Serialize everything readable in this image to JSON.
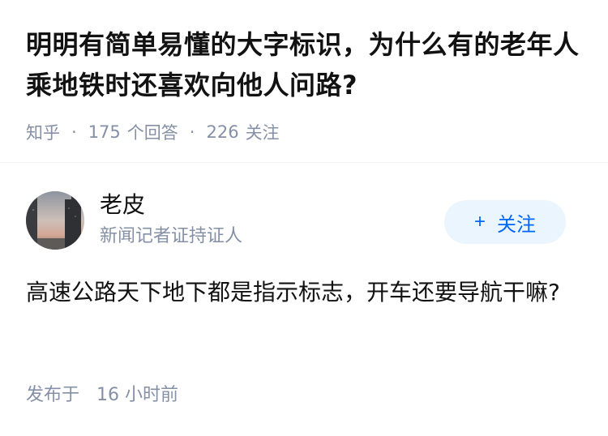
{
  "question": {
    "title": "明明有简单易懂的大字标识，为什么有的老年人乘地铁时还喜欢向他人问路?",
    "source": "知乎",
    "separator": "·",
    "answer_count": "175",
    "answer_label": "个回答",
    "follower_count": "226",
    "follower_label": "关注"
  },
  "answer": {
    "author": {
      "name": "老皮",
      "description": "新闻记者证持证人",
      "avatar_icon": "avatar-photo"
    },
    "follow_button": {
      "icon": "plus-icon",
      "icon_glyph": "+",
      "label": "关注"
    },
    "content": "高速公路天下地下都是指示标志，开车还要导航干嘛?",
    "time_label": "发布于",
    "time_value": "16 小时前"
  },
  "colors": {
    "title": "#121212",
    "meta": "#8590a6",
    "accent": "#0066ff",
    "follow_bg": "#ebf5fd",
    "divider": "#f0f2f5"
  }
}
